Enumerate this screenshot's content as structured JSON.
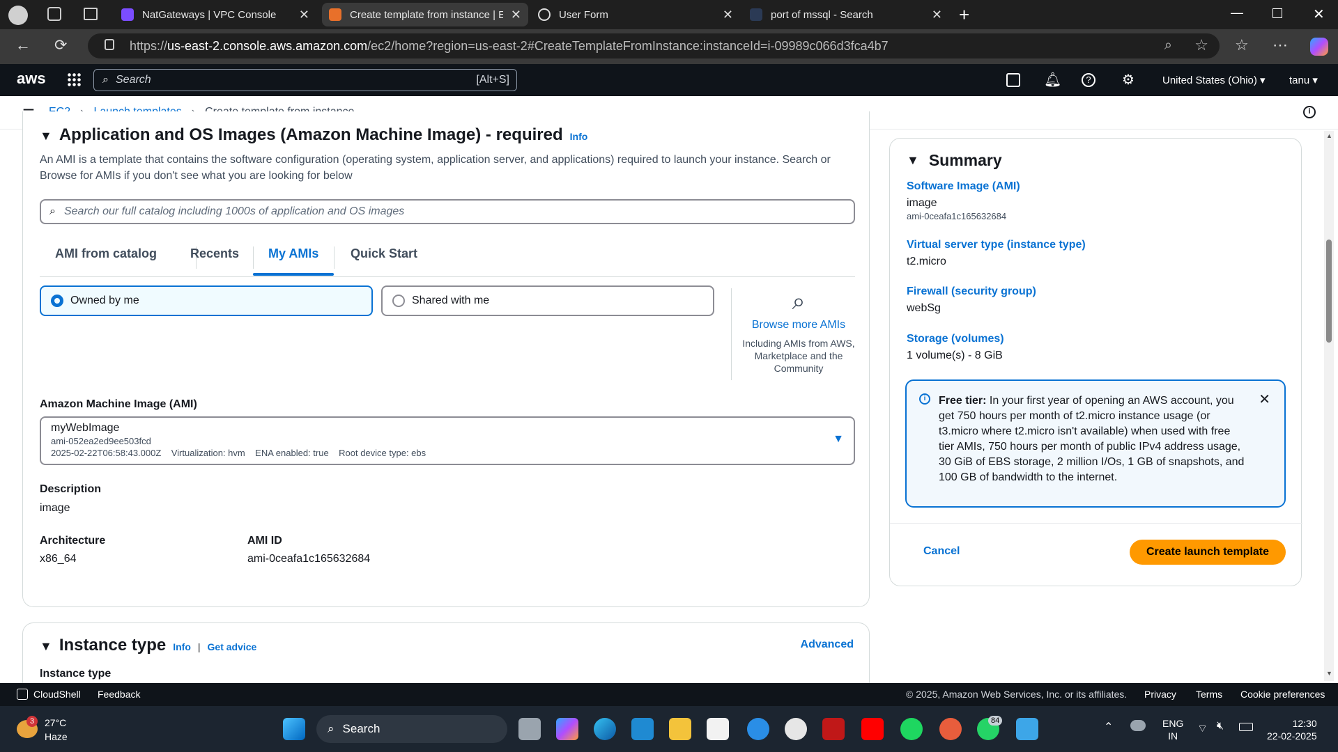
{
  "browser": {
    "tabs": [
      {
        "title": "NatGateways | VPC Console"
      },
      {
        "title": "Create template from instance | E"
      },
      {
        "title": "User Form"
      },
      {
        "title": "port of mssql - Search"
      }
    ],
    "url_prefix": "https://",
    "url_domain": "us-east-2.console.aws.amazon.com",
    "url_path": "/ec2/home?region=us-east-2#CreateTemplateFromInstance:instanceId=i-09989c066d3fca4b7"
  },
  "aws_header": {
    "logo": "aws",
    "search_placeholder": "Search",
    "search_shortcut": "[Alt+S]",
    "region": "United States (Ohio) ▾",
    "user": "tanu ▾"
  },
  "breadcrumb": {
    "items": [
      "EC2",
      "Launch templates",
      "Create template from instance"
    ]
  },
  "ami_section": {
    "title": "Application and OS Images (Amazon Machine Image) - required",
    "info": "Info",
    "description": "An AMI is a template that contains the software configuration (operating system, application server, and applications) required to launch your instance. Search or Browse for AMIs if you don't see what you are looking for below",
    "search_placeholder": "Search our full catalog including 1000s of application and OS images",
    "tabs": [
      "AMI from catalog",
      "Recents",
      "My AMIs",
      "Quick Start"
    ],
    "active_tab": "My AMIs",
    "radio_owned": "Owned by me",
    "radio_shared": "Shared with me",
    "browse_link": "Browse more AMIs",
    "browse_desc": "Including AMIs from AWS, Marketplace and the Community",
    "ami_label": "Amazon Machine Image (AMI)",
    "ami_name": "myWebImage",
    "ami_id_small": "ami-052ea2ed9ee503fcd",
    "ami_meta": "2025-02-22T06:58:43.000Z    Virtualization: hvm    ENA enabled: true    Root device type: ebs",
    "desc_label": "Description",
    "desc_value": "image",
    "arch_label": "Architecture",
    "arch_value": "x86_64",
    "amiid_label": "AMI ID",
    "amiid_value": "ami-0ceafa1c165632684"
  },
  "instance_section": {
    "title": "Instance type",
    "info": "Info",
    "advice": "Get advice",
    "advanced": "Advanced",
    "subtitle": "Instance type"
  },
  "summary": {
    "title": "Summary",
    "ami_label": "Software Image (AMI)",
    "ami_value": "image",
    "ami_id": "ami-0ceafa1c165632684",
    "type_label": "Virtual server type (instance type)",
    "type_value": "t2.micro",
    "fw_label": "Firewall (security group)",
    "fw_value": "webSg",
    "storage_label": "Storage (volumes)",
    "storage_value": "1 volume(s) - 8 GiB",
    "free_tier_bold": "Free tier:",
    "free_tier_text": " In your first year of opening an AWS account, you get 750 hours per month of t2.micro instance usage (or t3.micro where t2.micro isn't available) when used with free tier AMIs, 750 hours per month of public IPv4 address usage, 30 GiB of EBS storage, 2 million I/Os, 1 GB of snapshots, and 100 GB of bandwidth to the internet.",
    "cancel": "Cancel",
    "create": "Create launch template"
  },
  "footer": {
    "cloudshell": "CloudShell",
    "feedback": "Feedback",
    "copyright": "© 2025, Amazon Web Services, Inc. or its affiliates.",
    "privacy": "Privacy",
    "terms": "Terms",
    "cookies": "Cookie preferences"
  },
  "taskbar": {
    "temp": "27°C",
    "weather": "Haze",
    "weather_badge": "3",
    "search": "Search",
    "whatsapp_badge": "84",
    "lang1": "ENG",
    "lang2": "IN",
    "time": "12:30",
    "date": "22-02-2025"
  },
  "colors": {
    "accent": "#0972d3",
    "primary_button": "#ff9900",
    "header": "#0f141a"
  }
}
